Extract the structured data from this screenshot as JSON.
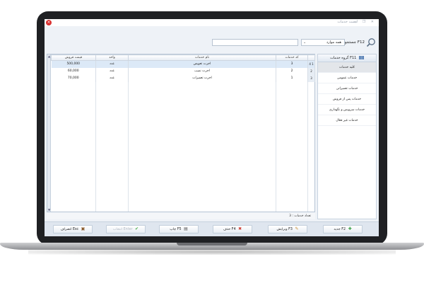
{
  "window": {
    "title": "لیست خدمات",
    "controls": "— ❐ ✕"
  },
  "search": {
    "label": "جستجو F12",
    "filter_value": "همه موارد",
    "input_value": ""
  },
  "grid": {
    "columns": [
      "",
      "کد خدمات",
      "نام خدمات",
      "واحد",
      "قیمت فروش"
    ],
    "rows": [
      {
        "indicator": "4 1",
        "code": "3",
        "name": "اجرت تعویض",
        "unit": "عدد",
        "price": "500,000"
      },
      {
        "indicator": "2",
        "code": "2",
        "name": "اجرت نصب",
        "unit": "عدد",
        "price": "60,000"
      },
      {
        "indicator": "3",
        "code": "1",
        "name": "اجرت تعمیرات",
        "unit": "عدد",
        "price": "70,000"
      }
    ],
    "count_label": "تعداد خدمات : 3"
  },
  "side_panel": {
    "header": "گروه خدمات F11",
    "items": [
      {
        "label": "کلیه خدمات",
        "active": true
      },
      {
        "label": "خدمات عمومی",
        "active": false
      },
      {
        "label": "خدمات تعمیراتی",
        "active": false
      },
      {
        "label": "خدمات پس از فروش",
        "active": false
      },
      {
        "label": "خدمات سرویس و نگهداری",
        "active": false
      },
      {
        "label": "خدمات غیر فعال",
        "active": false
      }
    ]
  },
  "buttons": {
    "new": "جدید F2",
    "edit": "ویرایش F3",
    "delete": "حذف F4",
    "print": "چاپ F5",
    "select": "انتخاب Enter",
    "cancel": "انصراف Esc"
  },
  "colors": {
    "accent": "#dce9f7",
    "close": "#d9302f",
    "new_icon": "#2e9a3a",
    "delete_icon": "#d03a2f",
    "select_icon": "#4bb04b"
  },
  "icons": {
    "search": "search-icon",
    "new": "plus-icon",
    "edit": "pencil-icon",
    "delete": "cross-icon",
    "print": "printer-icon",
    "select": "check-icon",
    "cancel": "exit-icon"
  }
}
